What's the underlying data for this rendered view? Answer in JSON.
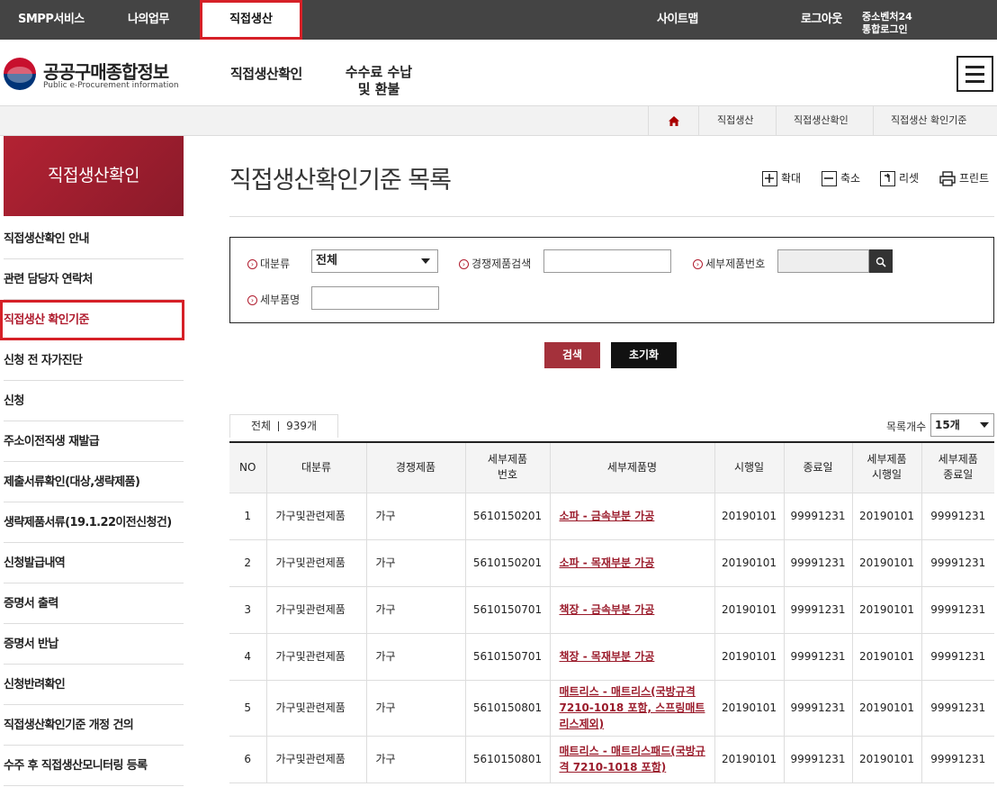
{
  "topbar": {
    "smpp": "SMPP서비스",
    "mywork": "나의업무",
    "active_tab": "직접생산",
    "sitemap": "사이트맵",
    "logout": "로그아웃",
    "sso_line1": "중소벤처24",
    "sso_line2": "통합로그인"
  },
  "header": {
    "logo_title": "공공구매종합정보",
    "logo_sub": "Public e-Procurement information",
    "gnb_1": "직접생산확인",
    "gnb_2": "수수료 수납 및 환불"
  },
  "breadcrumb": [
    "직접생산",
    "직접생산확인",
    "직접생산 확인기준"
  ],
  "sidebar": {
    "title": "직접생산확인",
    "items": [
      "직접생산확인 안내",
      "관련 담당자 연락처",
      "직접생산 확인기준",
      "신청 전 자가진단",
      "신청",
      "주소이전직생 재발급",
      "제출서류확인(대상,생략제품)",
      "생략제품서류(19.1.22이전신청건)",
      "신청발급내역",
      "증명서 출력",
      "증명서 반납",
      "신청반려확인",
      "직접생산확인기준 개정 건의",
      "수주 후 직접생산모니터링 등록"
    ]
  },
  "page": {
    "title": "직접생산확인기준 목록",
    "tool_zoom_in": "확대",
    "tool_zoom_out": "축소",
    "tool_reset": "리셋",
    "tool_print": "프린트"
  },
  "search": {
    "label_category": "대분류",
    "category_value": "전체",
    "label_product": "경쟁제품검색",
    "product_value": "",
    "label_detail_no": "세부제품번호",
    "detail_no_value": "",
    "label_detail_name": "세부품명",
    "detail_name_value": "",
    "btn_search": "검색",
    "btn_reset": "초기화"
  },
  "list": {
    "total_label": "전체",
    "total_count": "939개",
    "pagesize_label": "목록개수",
    "pagesize_value": "15개",
    "headers": [
      "NO",
      "대분류",
      "경쟁제품",
      "세부제품\n번호",
      "세부제품명",
      "시행일",
      "종료일",
      "세부제품\n시행일",
      "세부제품\n종료일"
    ],
    "rows": [
      {
        "no": "1",
        "cat": "가구및관련제품",
        "comp": "가구",
        "code": "5610150201",
        "name": "소파 - 금속부분 가공",
        "start": "20190101",
        "end": "99991231",
        "dstart": "20190101",
        "dend": "99991231"
      },
      {
        "no": "2",
        "cat": "가구및관련제품",
        "comp": "가구",
        "code": "5610150201",
        "name": "소파 - 목재부분 가공",
        "start": "20190101",
        "end": "99991231",
        "dstart": "20190101",
        "dend": "99991231"
      },
      {
        "no": "3",
        "cat": "가구및관련제품",
        "comp": "가구",
        "code": "5610150701",
        "name": "책장 - 금속부분 가공",
        "start": "20190101",
        "end": "99991231",
        "dstart": "20190101",
        "dend": "99991231"
      },
      {
        "no": "4",
        "cat": "가구및관련제품",
        "comp": "가구",
        "code": "5610150701",
        "name": "책장 - 목재부분 가공",
        "start": "20190101",
        "end": "99991231",
        "dstart": "20190101",
        "dend": "99991231"
      },
      {
        "no": "5",
        "cat": "가구및관련제품",
        "comp": "가구",
        "code": "5610150801",
        "name": "매트리스 - 매트리스(국방규격 7210-1018 포함, 스프링매트리스제외)",
        "start": "20190101",
        "end": "99991231",
        "dstart": "20190101",
        "dend": "99991231"
      },
      {
        "no": "6",
        "cat": "가구및관련제품",
        "comp": "가구",
        "code": "5610150801",
        "name": "매트리스 - 매트리스패드(국방규격 7210-1018 포함)",
        "start": "20190101",
        "end": "99991231",
        "dstart": "20190101",
        "dend": "99991231"
      }
    ]
  }
}
